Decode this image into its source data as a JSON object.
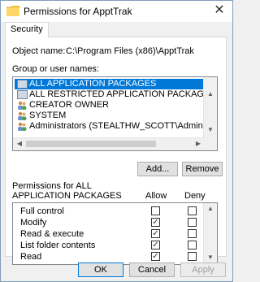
{
  "window": {
    "title": "Permissions for ApptTrak"
  },
  "tabs": [
    {
      "label": "Security"
    }
  ],
  "object": {
    "label": "Object name:",
    "value": "C:\\Program Files (x86)\\ApptTrak"
  },
  "groups": {
    "label": "Group or user names:",
    "items": [
      {
        "label": "ALL APPLICATION PACKAGES",
        "icon": "package-icon",
        "selected": true
      },
      {
        "label": "ALL RESTRICTED APPLICATION PACKAGES",
        "icon": "package-icon",
        "selected": false
      },
      {
        "label": "CREATOR OWNER",
        "icon": "users-icon",
        "selected": false
      },
      {
        "label": "SYSTEM",
        "icon": "users-icon",
        "selected": false
      },
      {
        "label": "Administrators (STEALTHW_SCOTT\\Administrators)",
        "icon": "users-icon",
        "selected": false
      }
    ]
  },
  "buttons": {
    "add": "Add...",
    "remove": "Remove",
    "ok": "OK",
    "cancel": "Cancel",
    "apply": "Apply"
  },
  "permissions": {
    "label_line1": "Permissions for ALL",
    "label_line2": "APPLICATION PACKAGES",
    "allow_header": "Allow",
    "deny_header": "Deny",
    "rows": [
      {
        "name": "Full control",
        "allow": false,
        "deny": false
      },
      {
        "name": "Modify",
        "allow": true,
        "deny": false
      },
      {
        "name": "Read & execute",
        "allow": true,
        "deny": false
      },
      {
        "name": "List folder contents",
        "allow": true,
        "deny": false
      },
      {
        "name": "Read",
        "allow": true,
        "deny": false
      }
    ]
  }
}
